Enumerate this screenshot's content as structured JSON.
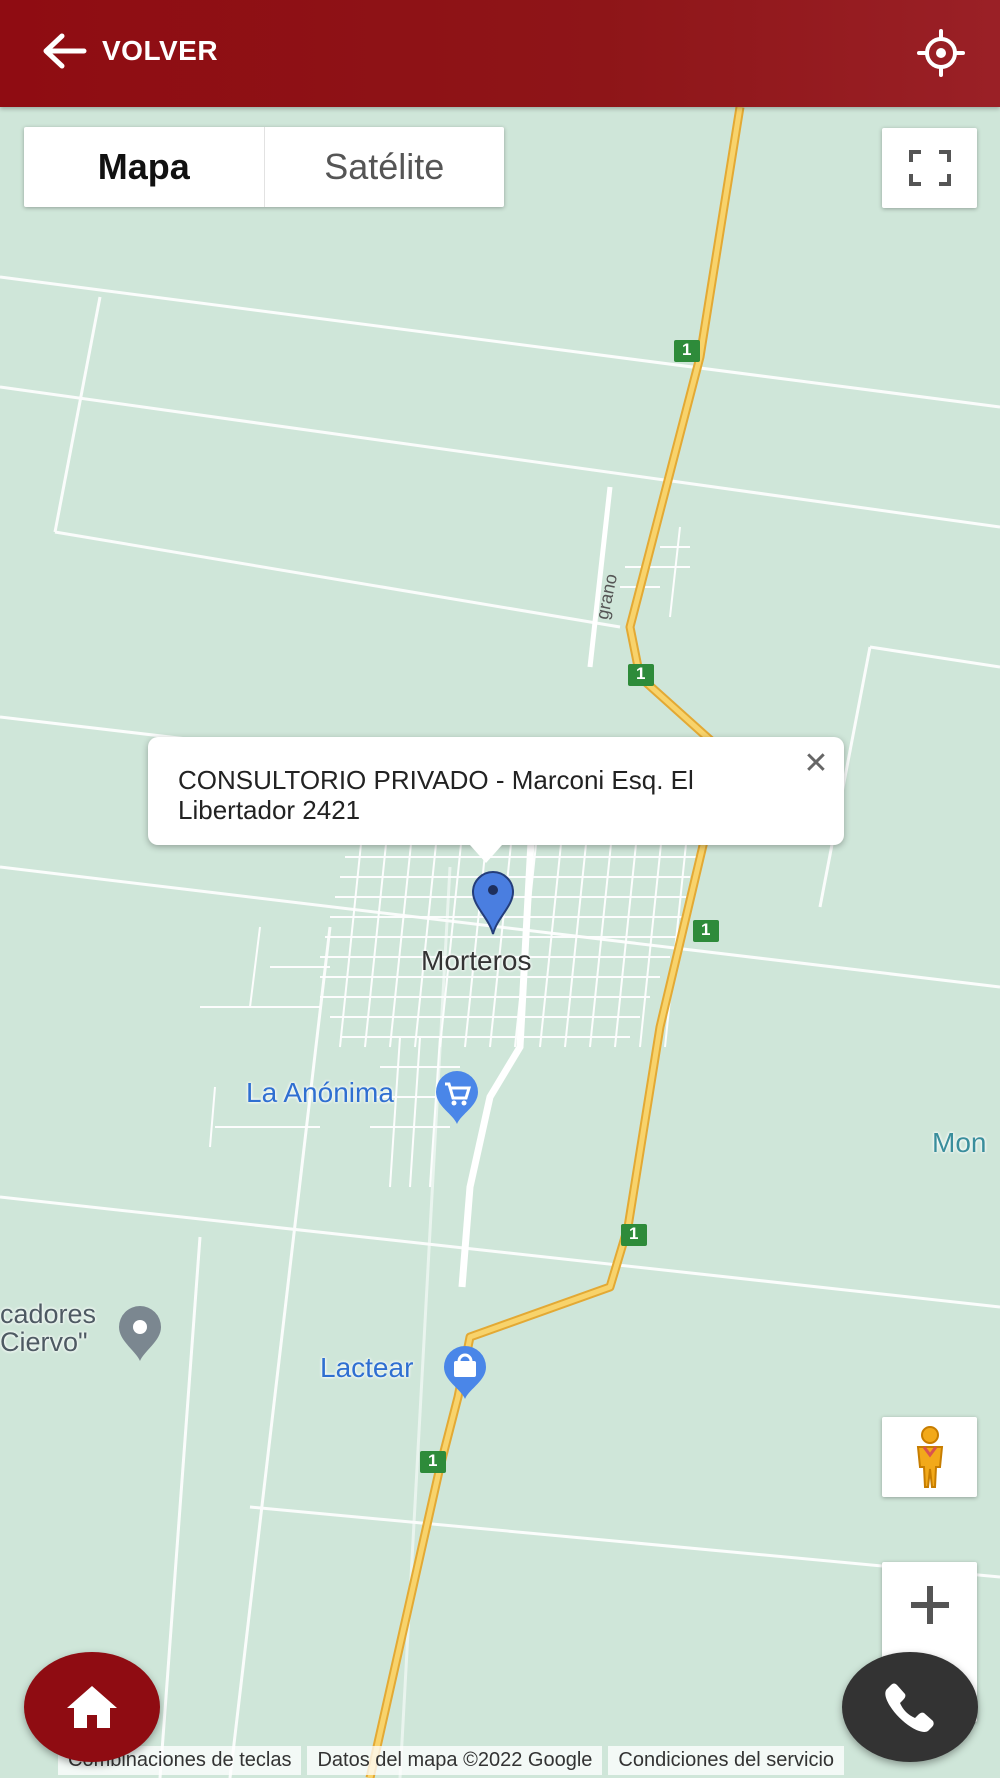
{
  "header": {
    "back_label": "VOLVER",
    "back_icon": "arrow-left-icon",
    "locate_icon": "crosshair-icon"
  },
  "map_type": {
    "map_label": "Mapa",
    "satellite_label": "Satélite",
    "selected": "Mapa"
  },
  "controls": {
    "fullscreen_icon": "fullscreen-icon",
    "pegman_icon": "pegman-icon",
    "zoom_in_icon": "plus-icon"
  },
  "info_window": {
    "text": "CONSULTORIO PRIVADO - Marconi Esq. El Libertador 2421",
    "close_icon": "close-icon"
  },
  "map_labels": {
    "town": "Morteros",
    "poi_1": "La Anónima",
    "poi_2": "Lactear",
    "poi_3_line1": "cadores",
    "poi_3_line2": "Ciervo\"",
    "edge_label": "Mon",
    "street": "grano",
    "route_shield": "1"
  },
  "fab": {
    "home_icon": "home-icon",
    "phone_icon": "phone-icon"
  },
  "attribution": {
    "shortcuts": "Combinaciones de teclas",
    "map_data": "Datos del mapa ©2022 Google",
    "terms": "Condiciones del servicio"
  },
  "colors": {
    "header": "#8f0c12",
    "map_bg": "#cfe6d9",
    "road": "#f6c75a",
    "poi_blue": "#3f7fe0",
    "fab_home": "#8f0c12",
    "fab_phone": "#333333"
  }
}
